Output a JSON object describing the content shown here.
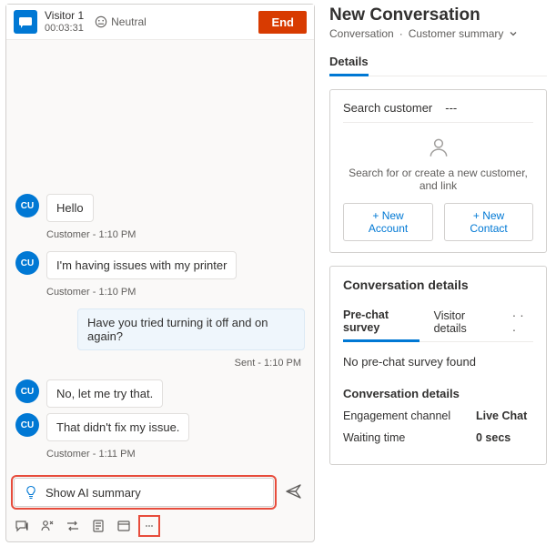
{
  "chat": {
    "visitor": {
      "name": "Visitor 1",
      "timer": "00:03:31"
    },
    "sentiment": "Neutral",
    "endLabel": "End",
    "customerAvatar": "CU",
    "messages": [
      {
        "from": "customer",
        "text": "Hello",
        "meta": "Customer - 1:10 PM"
      },
      {
        "from": "customer",
        "text": "I'm having issues with my printer",
        "meta": "Customer - 1:10 PM"
      },
      {
        "from": "agent",
        "text": "Have you tried turning it off and on again?",
        "meta": "Sent - 1:10 PM"
      },
      {
        "from": "customer",
        "text": "No, let me try that.",
        "meta": ""
      },
      {
        "from": "customer",
        "text": "That didn't fix my issue.",
        "meta": "Customer - 1:11 PM"
      }
    ],
    "aiSummaryLabel": "Show AI summary"
  },
  "panel": {
    "title": "New Conversation",
    "breadcrumb": [
      "Conversation",
      "Customer summary"
    ],
    "tabs": {
      "details": "Details"
    },
    "customer": {
      "searchLabel": "Search customer",
      "searchValue": "---",
      "emptyText": "Search for or create a new customer, and link",
      "newAccount": "+ New Account",
      "newContact": "+ New Contact"
    },
    "conv": {
      "title": "Conversation details",
      "tabPre": "Pre-chat survey",
      "tabVisitor": "Visitor details",
      "surveyEmpty": "No pre-chat survey found",
      "subhead": "Conversation details",
      "channelK": "Engagement channel",
      "channelV": "Live Chat",
      "waitK": "Waiting time",
      "waitV": "0 secs"
    }
  }
}
